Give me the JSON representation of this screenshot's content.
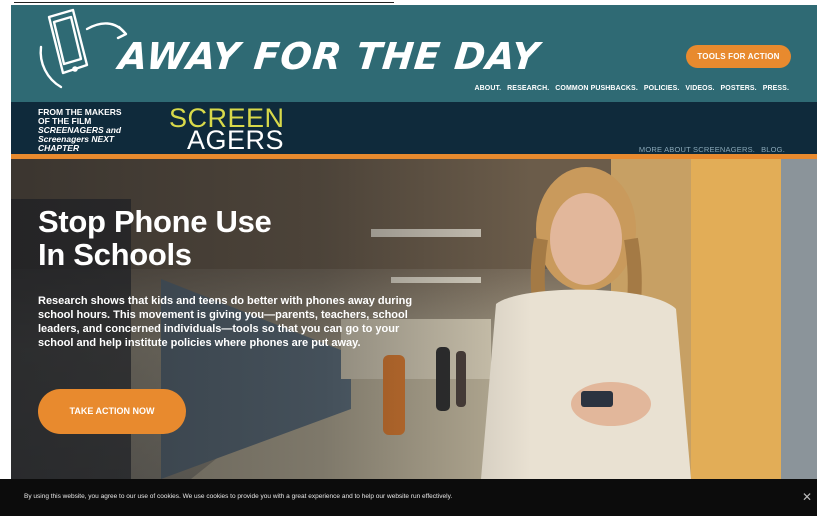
{
  "header": {
    "logo_text": "AWAY FOR THE DAY",
    "tools_button": "TOOLS FOR ACTION",
    "nav": [
      "ABOUT.",
      "RESEARCH.",
      "COMMON PUSHBACKS.",
      "POLICIES.",
      "VIDEOS.",
      "POSTERS.",
      "PRESS."
    ]
  },
  "subheader": {
    "makers_line1": "FROM THE MAKERS",
    "makers_line2": "OF THE FILM",
    "makers_line3": "SCREENAGERS and",
    "makers_line4": "Screenagers NEXT",
    "makers_line5": "CHAPTER",
    "logo_top": "SCREEN",
    "logo_bottom": "AGERS",
    "nav": [
      "MORE ABOUT SCREENAGERS.",
      "BLOG."
    ]
  },
  "hero": {
    "title_line1": "Stop Phone Use",
    "title_line2": "In Schools",
    "body": "Research shows that kids and teens do better with phones away during school hours. This movement is giving you—parents, teachers, school leaders, and concerned individuals—tools so that you can go to your school and help institute policies where phones are put away.",
    "cta": "TAKE ACTION NOW"
  },
  "cookie": {
    "text": "By using this website, you agree to our use of cookies. We use cookies to provide you with a great experience and to help our website run effectively.",
    "close": "✕"
  },
  "colors": {
    "header_teal": "#2f6a74",
    "subheader_navy": "#0f2a3b",
    "accent_orange": "#e88a2e",
    "screen_yellow": "#d8d94a"
  }
}
